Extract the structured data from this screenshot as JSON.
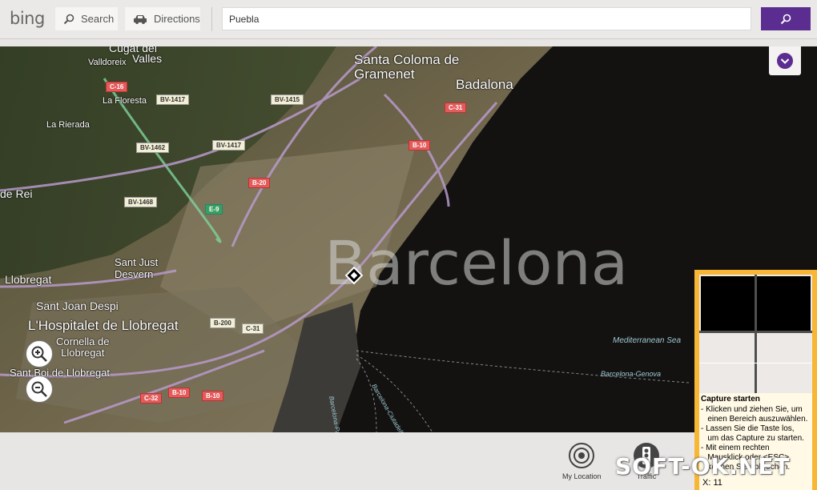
{
  "app": {
    "logo": "bing",
    "brand_color": "#5c2d91"
  },
  "nav": {
    "search_label": "Search",
    "directions_label": "Directions"
  },
  "search": {
    "value": "Puebla"
  },
  "map": {
    "city": "Barcelona",
    "places": {
      "santa_coloma": "Santa Coloma de\nGramenet",
      "badalona": "Badalona",
      "cugat": "Cugat del",
      "valles": "Valles",
      "valldoreix": "Valldoreix",
      "la_floresta": "La Floresta",
      "la_rierada": "La Rierada",
      "de_rei": "de Rei",
      "sant_just": "Sant Just\nDesvern",
      "llobregat": "Llobregat",
      "sant_joan_despi": "Sant Joan Despi",
      "hospitalet": "L'Hospitalet de Llobregat",
      "cornella": "Cornella de\nLlobregat",
      "sant_boi": "Sant Boi de Llobregat"
    },
    "sea_labels": {
      "mediterranean": "Mediterranean Sea",
      "genova": "Barcelona-Genova",
      "palma": "Barcelona-Palma",
      "ciutadella": "Barcelona-Ciutadella"
    },
    "roads": [
      "C-16",
      "BV-1417",
      "BV-1415",
      "BV-1462",
      "BV-1417",
      "BV-1468",
      "B-20",
      "E-9",
      "C-31",
      "B-10",
      "B-200",
      "C-31",
      "C-32",
      "B-10",
      "B-10"
    ]
  },
  "bottom": {
    "my_location": "My Location",
    "traffic": "Traffic"
  },
  "capture": {
    "title": "Capture starten",
    "lines": "- Klicken und ziehen Sie, um\n   einen Bereich auszuwählen.\n- Lassen Sie die Taste los,\n   um das Capture zu starten.\n- Mit einem rechten\n   Mausklick oder <ESC>\n   können Sie abbrechen.",
    "coords": "X: 11"
  },
  "watermark": "SOFT-OK.NET",
  "icons": {
    "search": "search-icon",
    "directions": "car-icon",
    "submit": "search-icon",
    "collapse": "chevron-down-icon",
    "zoom_in": "zoom-in-icon",
    "zoom_out": "zoom-out-icon",
    "location": "target-icon",
    "traffic": "traffic-light-icon"
  }
}
